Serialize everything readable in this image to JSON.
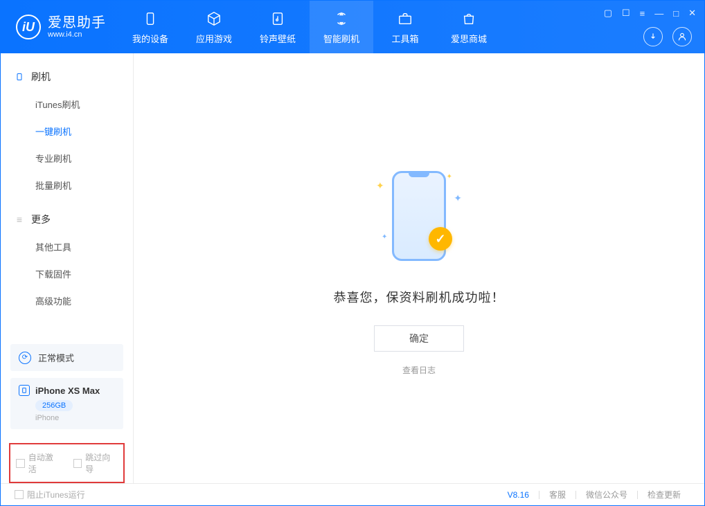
{
  "app": {
    "logo_letter": "iU",
    "name": "爱思助手",
    "website": "www.i4.cn"
  },
  "nav": [
    {
      "label": "我的设备",
      "icon": "device"
    },
    {
      "label": "应用游戏",
      "icon": "cube"
    },
    {
      "label": "铃声壁纸",
      "icon": "music"
    },
    {
      "label": "智能刷机",
      "icon": "refresh",
      "active": true
    },
    {
      "label": "工具箱",
      "icon": "toolbox"
    },
    {
      "label": "爱思商城",
      "icon": "bag"
    }
  ],
  "sidebar": {
    "section1": {
      "title": "刷机",
      "items": [
        "iTunes刷机",
        "一键刷机",
        "专业刷机",
        "批量刷机"
      ],
      "active_index": 1
    },
    "section2": {
      "title": "更多",
      "items": [
        "其他工具",
        "下载固件",
        "高级功能"
      ]
    }
  },
  "mode": {
    "label": "正常模式"
  },
  "device": {
    "name": "iPhone XS Max",
    "capacity": "256GB",
    "type": "iPhone"
  },
  "checks": {
    "auto_activate": "自动激活",
    "skip_guide": "跳过向导"
  },
  "main": {
    "success": "恭喜您，保资料刷机成功啦！",
    "ok": "确定",
    "view_log": "查看日志"
  },
  "footer": {
    "block_itunes": "阻止iTunes运行",
    "version": "V8.16",
    "support": "客服",
    "wechat": "微信公众号",
    "update": "检查更新"
  }
}
